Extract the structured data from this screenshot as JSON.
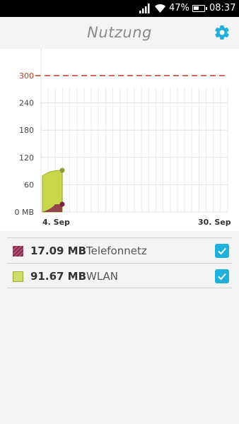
{
  "status_bar": {
    "battery_percent": "47%",
    "time": "08:37"
  },
  "header": {
    "title": "Nutzung",
    "settings_icon": "gear-icon"
  },
  "chart_data": {
    "type": "area",
    "yunit": "MB",
    "yticks": [
      "300",
      "240",
      "180",
      "120",
      "60",
      "0 MB"
    ],
    "ylim": [
      0,
      300
    ],
    "limit_line": 300,
    "x_start_label": "4. Sep",
    "x_end_label": "30. Sep",
    "series": [
      {
        "name": "Telefonnetz",
        "values": [
          0,
          17.09
        ],
        "color": "#8b2d4e"
      },
      {
        "name": "WLAN",
        "values": [
          0,
          91.67
        ],
        "color": "#c9d84a"
      }
    ],
    "grid": true
  },
  "legend": [
    {
      "amount": "17.09 MB",
      "label": "Telefonnetz",
      "checked": true,
      "color": "#8b2d4e"
    },
    {
      "amount": "91.67 MB",
      "label": "WLAN",
      "checked": true,
      "color": "#cedc6b"
    }
  ],
  "colors": {
    "accent": "#1fb0dc",
    "limit_line": "#c0392b"
  }
}
